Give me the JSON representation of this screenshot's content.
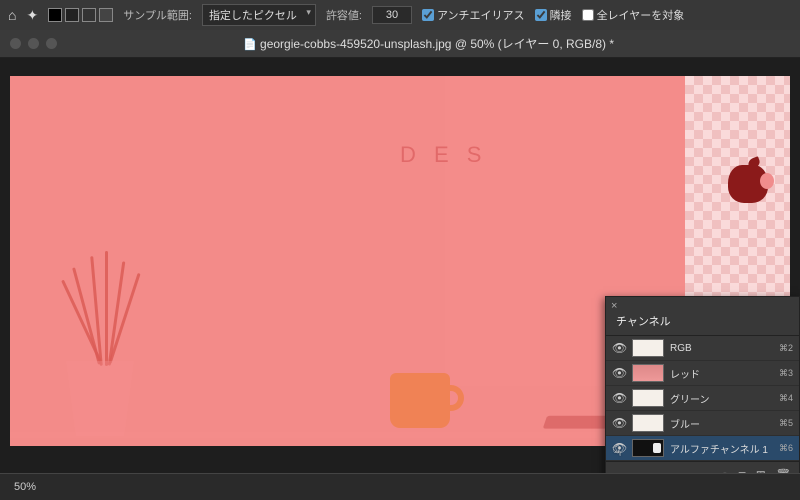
{
  "topbar": {
    "sample_label": "サンプル範囲:",
    "sample_value": "指定したピクセル",
    "tolerance_label": "許容値:",
    "tolerance_value": "30",
    "antialias": "アンチエイリアス",
    "contiguous": "隣接",
    "all_layers": "全レイヤーを対象"
  },
  "title": "georgie-cobbs-459520-unsplash.jpg @ 50% (レイヤー 0, RGB/8) *",
  "scene": {
    "desk_text": "D E S"
  },
  "panel": {
    "tab": "チャンネル",
    "rows": [
      {
        "name": "RGB",
        "key": "⌘2"
      },
      {
        "name": "レッド",
        "key": "⌘3"
      },
      {
        "name": "グリーン",
        "key": "⌘4"
      },
      {
        "name": "ブルー",
        "key": "⌘5"
      },
      {
        "name": "アルファチャンネル 1",
        "key": "⌘6"
      }
    ]
  },
  "status": {
    "zoom": "50%"
  }
}
